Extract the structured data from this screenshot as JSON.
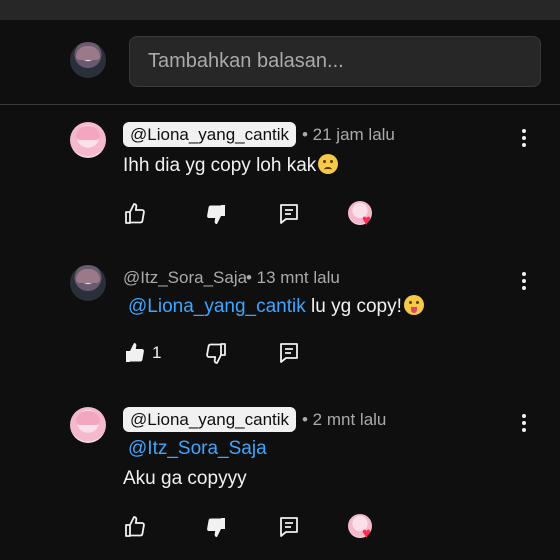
{
  "reply_box": {
    "placeholder": "Tambahkan balasan..."
  },
  "comments": [
    {
      "author": "@Liona_yang_cantik",
      "meta": "• 21 jam lalu",
      "text": "Ihh dia yg copy loh kak",
      "emoji": "crying-face",
      "likes": "",
      "liked": false,
      "disliked": true,
      "creator_heart": true
    },
    {
      "author": "@Itz_Sora_Saja",
      "meta": "• 13 mnt lalu",
      "mention": "@Liona_yang_cantik",
      "text": "lu yg copy!",
      "emoji": "squinting-tongue-face",
      "likes": "1",
      "liked": true,
      "disliked": false,
      "creator_heart": false
    },
    {
      "author": "@Liona_yang_cantik",
      "meta": "• 2 mnt lalu",
      "mention": "@Itz_Sora_Saja",
      "text": "Aku ga copyyy",
      "likes": "",
      "liked": false,
      "disliked": true,
      "creator_heart": true
    }
  ],
  "colors": {
    "background": "#0f0f0f",
    "mention": "#3ea6ff",
    "heart": "#ff2c55"
  }
}
